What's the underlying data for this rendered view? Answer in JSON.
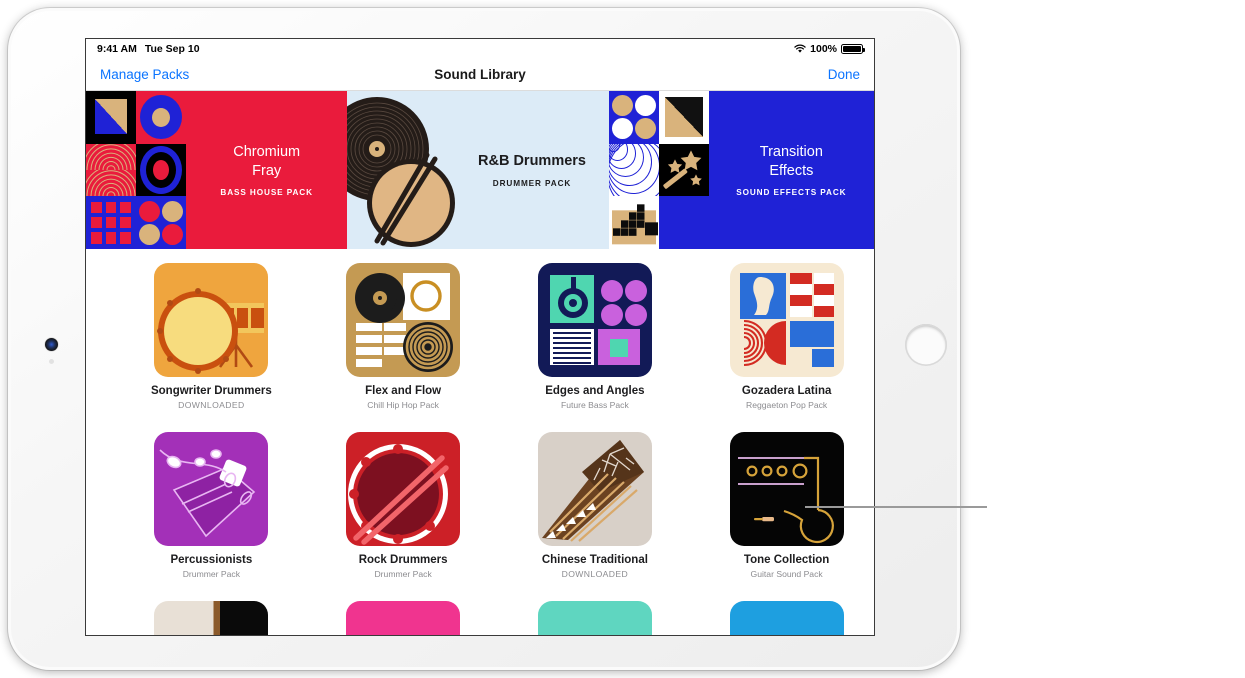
{
  "status_bar": {
    "time": "9:41 AM",
    "date": "Tue Sep 10",
    "wifi_icon": "wifi-icon",
    "battery_percent": "100%",
    "battery_icon": "battery-icon"
  },
  "nav_bar": {
    "left_button": "Manage Packs",
    "title": "Sound Library",
    "right_button": "Done"
  },
  "featured_banners": [
    {
      "title_line1": "Chromium",
      "title_line2": "Fray",
      "subtitle": "BASS HOUSE PACK",
      "background": "#ea1b3c",
      "text_color": "#ffffff",
      "artwork": "geometric-grid-red-blue"
    },
    {
      "title_line1": "R&B Drummers",
      "title_line2": "",
      "subtitle": "DRUMMER PACK",
      "background": "#dcebf7",
      "text_color": "#1d1d1f",
      "artwork": "vinyl-drum-sticks"
    },
    {
      "title_line1": "Transition",
      "title_line2": "Effects",
      "subtitle": "SOUND EFFECTS PACK",
      "background": "#1f22d6",
      "text_color": "#ffffff",
      "artwork": "geometric-grid-blue-tan"
    }
  ],
  "pack_rows": [
    [
      {
        "name": "Songwriter Drummers",
        "subtitle": "DOWNLOADED",
        "downloaded": true,
        "color": "#efa53e",
        "artwork": "drum-kit"
      },
      {
        "name": "Flex and Flow",
        "subtitle": "Chill Hip Hop Pack",
        "downloaded": false,
        "color": "#c49a53",
        "artwork": "turntable-keys"
      },
      {
        "name": "Edges and Angles",
        "subtitle": "Future Bass Pack",
        "downloaded": false,
        "color": "#121a57",
        "artwork": "headphones-shapes"
      },
      {
        "name": "Gozadera Latina",
        "subtitle": "Reggaeton Pop Pack",
        "downloaded": false,
        "color": "#f6e9d2",
        "artwork": "latin-blocks"
      }
    ],
    [
      {
        "name": "Percussionists",
        "subtitle": "Drummer Pack",
        "downloaded": false,
        "color": "#a330b8",
        "artwork": "congas-beads"
      },
      {
        "name": "Rock Drummers",
        "subtitle": "Drummer Pack",
        "downloaded": false,
        "color": "#cc2027",
        "artwork": "snare-sticks"
      },
      {
        "name": "Chinese Traditional",
        "subtitle": "DOWNLOADED",
        "downloaded": true,
        "color": "#d8d0c8",
        "artwork": "guzheng"
      },
      {
        "name": "Tone Collection",
        "subtitle": "Guitar Sound Pack",
        "downloaded": false,
        "color": "#050505",
        "artwork": "amp-cable"
      }
    ]
  ],
  "partial_row_colors": [
    "#e8e0d6",
    "#f0348f",
    "#5fd6c0",
    "#1e9fe0"
  ],
  "callout": {
    "name": "callout-line",
    "color": "#9a9a9a"
  },
  "device": {
    "home_button": "home-button",
    "camera": "front-camera"
  }
}
